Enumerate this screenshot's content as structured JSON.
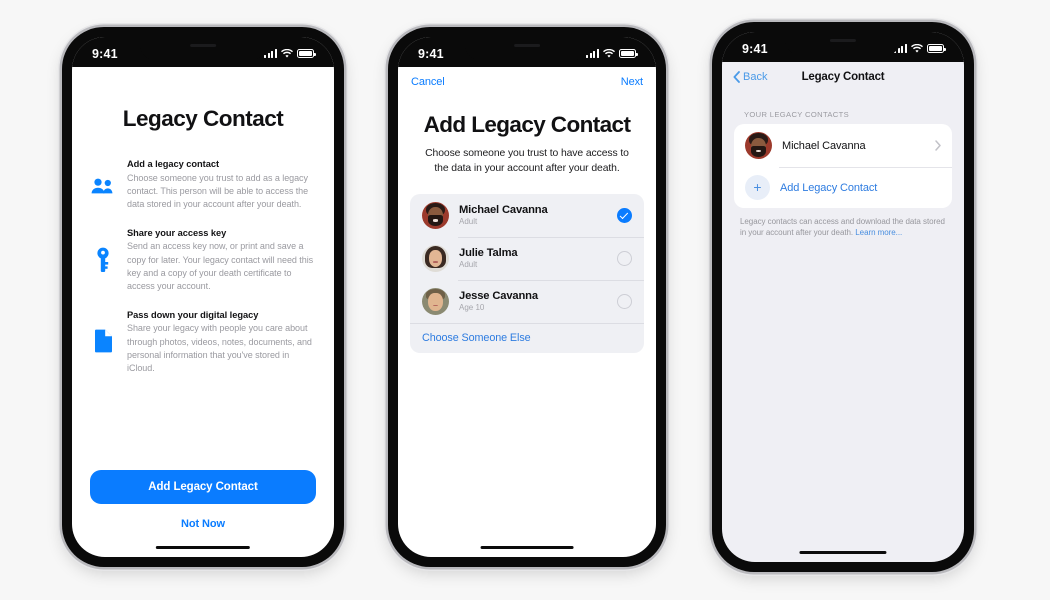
{
  "status_bar": {
    "time": "9:41",
    "signal_icon": "cellular-signal-icon",
    "wifi_icon": "wifi-icon",
    "battery_icon": "battery-icon"
  },
  "colors": {
    "accent_blue": "#0a7cff",
    "link_blue": "#2e7ce0",
    "page_background": "#f7f7f7",
    "card_gray": "#eff0f4",
    "ios_gray_background": "#efeff4",
    "muted_text": "#9a9aa0"
  },
  "phone1": {
    "title": "Legacy Contact",
    "features": [
      {
        "icon": "two-people-icon",
        "heading": "Add a legacy contact",
        "body": "Choose someone you trust to add as a legacy contact. This person will be able to access the data stored in your account after your death."
      },
      {
        "icon": "key-icon",
        "heading": "Share your access key",
        "body": "Send an access key now, or print and save a copy for later. Your legacy contact will need this key and a copy of your death certificate to access your account."
      },
      {
        "icon": "document-icon",
        "heading": "Pass down your digital legacy",
        "body": "Share your legacy with people you care about through photos, videos, notes, documents, and personal information that you've stored in iCloud."
      }
    ],
    "primary_button": "Add Legacy Contact",
    "secondary_button": "Not Now"
  },
  "phone2": {
    "nav": {
      "cancel": "Cancel",
      "next": "Next"
    },
    "title": "Add Legacy Contact",
    "subtitle": "Choose someone you trust to have access to the data in your account after your death.",
    "contacts": [
      {
        "name": "Michael Cavanna",
        "meta": "Adult",
        "selected": true,
        "avatar": "av-mike"
      },
      {
        "name": "Julie Talma",
        "meta": "Adult",
        "selected": false,
        "avatar": "av-julie"
      },
      {
        "name": "Jesse Cavanna",
        "meta": "Age 10",
        "selected": false,
        "avatar": "av-jesse"
      }
    ],
    "choose_someone_else": "Choose Someone Else"
  },
  "phone3": {
    "nav": {
      "back": "Back",
      "back_icon": "chevron-left-icon",
      "title": "Legacy Contact"
    },
    "section_label": "YOUR LEGACY CONTACTS",
    "contact": {
      "name": "Michael Cavanna",
      "avatar": "av-mike",
      "disclosure_icon": "chevron-right-icon"
    },
    "add_row": {
      "icon": "plus-icon",
      "label": "Add Legacy Contact"
    },
    "note": {
      "text": "Legacy contacts can access and download the data stored in your account after your death. ",
      "link": "Learn more..."
    }
  }
}
